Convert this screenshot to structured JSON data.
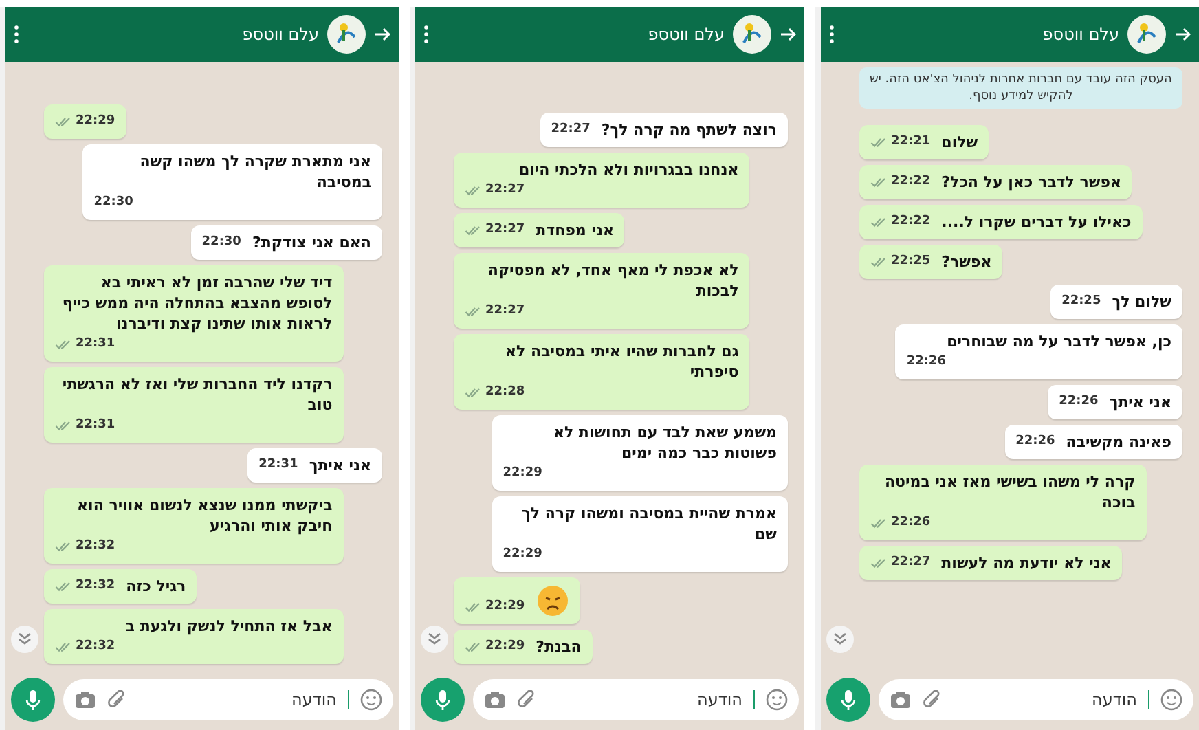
{
  "panels": [
    {
      "header": {
        "title": "עלם ווטספ"
      },
      "notice": "העסק הזה עובד עם חברות אחרות לניהול הצ'אט הזה. יש להקיש למידע נוסף.",
      "messages": [
        {
          "kind": "text",
          "sent": true,
          "text": "שלום",
          "time": "22:21"
        },
        {
          "kind": "text",
          "sent": true,
          "text": "אפשר לדבר כאן על הכל?",
          "time": "22:22"
        },
        {
          "kind": "text",
          "sent": true,
          "text": "כאילו על דברים שקרו ל....",
          "time": "22:22"
        },
        {
          "kind": "text",
          "sent": true,
          "text": "אפשר?",
          "time": "22:25"
        },
        {
          "kind": "text",
          "sent": false,
          "text": "שלום לך",
          "time": "22:25"
        },
        {
          "kind": "text",
          "sent": false,
          "text": "כן, אפשר לדבר על מה שבוחרים",
          "time": "22:26"
        },
        {
          "kind": "text",
          "sent": false,
          "text": "אני איתך",
          "time": "22:26"
        },
        {
          "kind": "text",
          "sent": false,
          "text": "פאינה מקשיבה",
          "time": "22:26"
        },
        {
          "kind": "text",
          "sent": true,
          "text": "קרה לי משהו בשישי מאז אני במיטה בוכה",
          "time": "22:26"
        },
        {
          "kind": "text",
          "sent": true,
          "text": "אני לא יודעת מה לעשות",
          "time": "22:27"
        }
      ],
      "input": {
        "placeholder": "הודעה"
      }
    },
    {
      "header": {
        "title": "עלם ווטספ"
      },
      "messages": [
        {
          "kind": "text",
          "sent": false,
          "text": "רוצה לשתף מה קרה לך?",
          "time": "22:27"
        },
        {
          "kind": "text",
          "sent": true,
          "text": "אנחנו בבגרויות ולא הלכתי היום",
          "time": "22:27"
        },
        {
          "kind": "text",
          "sent": true,
          "text": "אני מפחדת",
          "time": "22:27"
        },
        {
          "kind": "text",
          "sent": true,
          "text": "לא אכפת לי מאף אחד, לא מפסיקה לבכות",
          "time": "22:27"
        },
        {
          "kind": "text",
          "sent": true,
          "text": "גם לחברות שהיו איתי במסיבה לא סיפרתי",
          "time": "22:28"
        },
        {
          "kind": "text",
          "sent": false,
          "text": "משמע שאת לבד עם תחושות לא פשוטות כבר כמה ימים",
          "time": "22:29"
        },
        {
          "kind": "text",
          "sent": false,
          "text": "אמרת שהיית במסיבה ומשהו קרה לך שם",
          "time": "22:29"
        },
        {
          "kind": "emoji",
          "sent": true,
          "time": "22:29"
        },
        {
          "kind": "text",
          "sent": true,
          "text": "הבנת?",
          "time": "22:29"
        }
      ],
      "input": {
        "placeholder": "הודעה"
      }
    },
    {
      "header": {
        "title": "עלם ווטספ"
      },
      "messages": [
        {
          "kind": "text",
          "sent": true,
          "time": "22:29"
        },
        {
          "kind": "text",
          "sent": false,
          "text": "אני מתארת שקרה לך משהו קשה במסיבה",
          "time": "22:30"
        },
        {
          "kind": "text",
          "sent": false,
          "text": "האם אני צודקת?",
          "time": "22:30"
        },
        {
          "kind": "text",
          "sent": true,
          "text": "דיד שלי שהרבה זמן לא ראיתי בא לסופש מהצבא בהתחלה היה ממש כייף לראות אותו שתינו קצת ודיברנו",
          "time": "22:31"
        },
        {
          "kind": "text",
          "sent": true,
          "text": "רקדנו ליד החברות שלי ואז לא הרגשתי טוב",
          "time": "22:31"
        },
        {
          "kind": "text",
          "sent": false,
          "text": "אני איתך",
          "time": "22:31"
        },
        {
          "kind": "text",
          "sent": true,
          "text": "ביקשתי ממנו שנצא לנשום אוויר הוא חיבק אותי והרגיע",
          "time": "22:32"
        },
        {
          "kind": "text",
          "sent": true,
          "text": "רגיל כזה",
          "time": "22:32"
        },
        {
          "kind": "text",
          "sent": true,
          "text": "אבל אז התחיל לנשק ולגעת ב",
          "time": "22:32"
        }
      ],
      "input": {
        "placeholder": "הודעה"
      }
    }
  ]
}
